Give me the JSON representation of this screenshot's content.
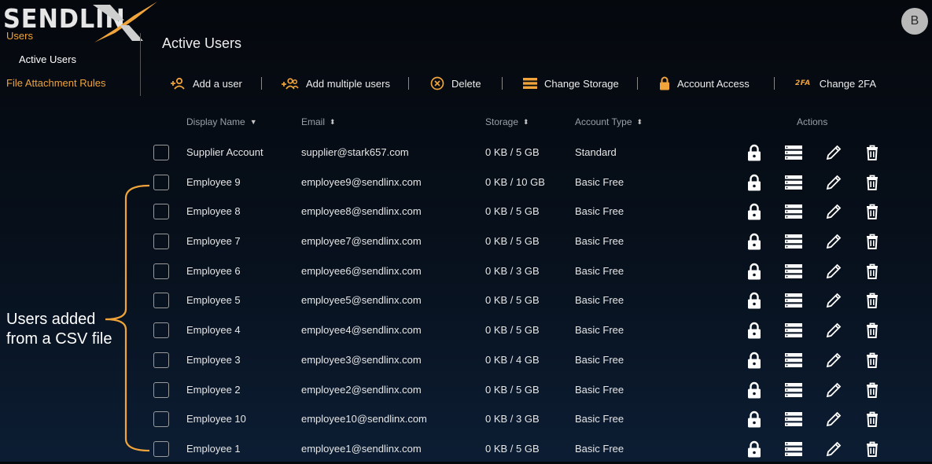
{
  "brand": {
    "logo_text": "SENDLIN"
  },
  "sidebar": {
    "users": "Users",
    "active_users": "Active Users",
    "file_attachment_rules": "File Attachment Rules"
  },
  "header": {
    "title": "Active Users",
    "avatar_initial": "B"
  },
  "toolbar": {
    "add_user": "Add a user",
    "add_multiple": "Add multiple users",
    "delete": "Delete",
    "change_storage": "Change Storage",
    "account_access": "Account Access",
    "twofa_badge": "2FA",
    "change_2fa": "Change 2FA"
  },
  "table": {
    "headers": {
      "display_name": "Display Name",
      "email": "Email",
      "storage": "Storage",
      "account_type": "Account Type",
      "actions": "Actions"
    },
    "rows": [
      {
        "name": "Supplier Account",
        "email": "supplier@stark657.com",
        "storage": "0 KB / 5 GB",
        "type": "Standard"
      },
      {
        "name": "Employee 9",
        "email": "employee9@sendlinx.com",
        "storage": "0 KB / 10 GB",
        "type": "Basic Free"
      },
      {
        "name": "Employee 8",
        "email": "employee8@sendlinx.com",
        "storage": "0 KB / 5 GB",
        "type": "Basic Free"
      },
      {
        "name": "Employee 7",
        "email": "employee7@sendlinx.com",
        "storage": "0 KB / 5 GB",
        "type": "Basic Free"
      },
      {
        "name": "Employee 6",
        "email": "employee6@sendlinx.com",
        "storage": "0 KB / 3 GB",
        "type": "Basic Free"
      },
      {
        "name": "Employee 5",
        "email": "employee5@sendlinx.com",
        "storage": "0 KB / 5 GB",
        "type": "Basic Free"
      },
      {
        "name": "Employee 4",
        "email": "employee4@sendlinx.com",
        "storage": "0 KB / 5 GB",
        "type": "Basic Free"
      },
      {
        "name": "Employee 3",
        "email": "employee3@sendlinx.com",
        "storage": "0 KB / 4 GB",
        "type": "Basic Free"
      },
      {
        "name": "Employee 2",
        "email": "employee2@sendlinx.com",
        "storage": "0 KB / 5 GB",
        "type": "Basic Free"
      },
      {
        "name": "Employee 10",
        "email": "employee10@sendlinx.com",
        "storage": "0 KB / 3 GB",
        "type": "Basic Free"
      },
      {
        "name": "Employee 1",
        "email": "employee1@sendlinx.com",
        "storage": "0 KB / 5 GB",
        "type": "Basic Free"
      }
    ]
  },
  "annotation": {
    "line1": "Users added",
    "line2": "from a CSV file"
  },
  "colors": {
    "accent": "#f0a43a",
    "text": "#e6e6e6",
    "muted": "#9aa0a8"
  },
  "icons": {
    "add_user": "add-user-icon",
    "add_multiple": "add-multiple-users-icon",
    "delete": "delete-circle-icon",
    "storage": "storage-icon",
    "lock": "lock-icon",
    "edit": "pencil-icon",
    "trash": "trash-icon"
  }
}
